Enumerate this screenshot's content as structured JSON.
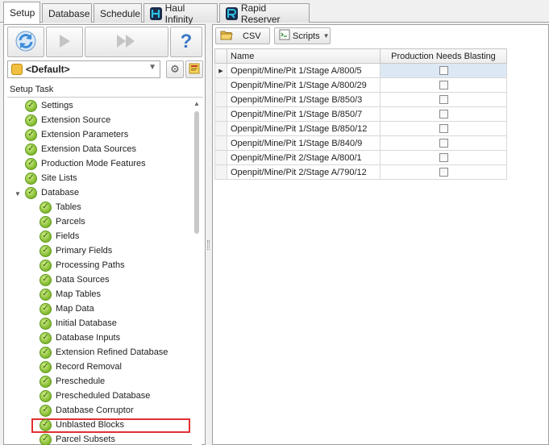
{
  "tabs": [
    {
      "label": "Setup",
      "active": true
    },
    {
      "label": "Database",
      "active": false
    },
    {
      "label": "Schedule",
      "active": false
    },
    {
      "label": "Haul Infinity",
      "active": false,
      "icon": "haul-infinity-logo",
      "color": "#1a2a4a"
    },
    {
      "label": "Rapid Reserver",
      "active": false,
      "icon": "rapid-reserver-logo",
      "color": "#1a2a4a"
    }
  ],
  "toolbar": {
    "refresh_icon": "refresh-icon",
    "run_icon": "play-icon",
    "run_all_icon": "fast-forward-icon",
    "help_label": "?"
  },
  "profile": {
    "selected": "<Default>",
    "settings_icon": "gear-icon",
    "notes_icon": "notes-icon"
  },
  "tree": {
    "header": "Setup Task",
    "items": [
      {
        "label": "Settings",
        "level": 0
      },
      {
        "label": "Extension Source",
        "level": 0
      },
      {
        "label": "Extension Parameters",
        "level": 0
      },
      {
        "label": "Extension Data Sources",
        "level": 0
      },
      {
        "label": "Production Mode Features",
        "level": 0
      },
      {
        "label": "Site Lists",
        "level": 0
      },
      {
        "label": "Database",
        "level": 0,
        "expanded": true
      },
      {
        "label": "Tables",
        "level": 1
      },
      {
        "label": "Parcels",
        "level": 1
      },
      {
        "label": "Fields",
        "level": 1
      },
      {
        "label": "Primary Fields",
        "level": 1
      },
      {
        "label": "Processing Paths",
        "level": 1
      },
      {
        "label": "Data Sources",
        "level": 1
      },
      {
        "label": "Map Tables",
        "level": 1
      },
      {
        "label": "Map Data",
        "level": 1
      },
      {
        "label": "Initial Database",
        "level": 1
      },
      {
        "label": "Database Inputs",
        "level": 1
      },
      {
        "label": "Extension Refined Database",
        "level": 1
      },
      {
        "label": "Record Removal",
        "level": 1
      },
      {
        "label": "Preschedule",
        "level": 1
      },
      {
        "label": "Prescheduled Database",
        "level": 1
      },
      {
        "label": "Database Corruptor",
        "level": 1
      },
      {
        "label": "Unblasted Blocks",
        "level": 1,
        "selected": true
      },
      {
        "label": "Parcel Subsets",
        "level": 1
      }
    ]
  },
  "right_toolbar": {
    "csv_label": "CSV",
    "scripts_label": "Scripts"
  },
  "grid": {
    "columns": [
      "Name",
      "Production Needs Blasting"
    ],
    "rows": [
      {
        "name": "Openpit/Mine/Pit 1/Stage A/800/5",
        "checked": false
      },
      {
        "name": "Openpit/Mine/Pit 1/Stage A/800/29",
        "checked": false
      },
      {
        "name": "Openpit/Mine/Pit 1/Stage B/850/3",
        "checked": false
      },
      {
        "name": "Openpit/Mine/Pit 1/Stage B/850/7",
        "checked": false
      },
      {
        "name": "Openpit/Mine/Pit 1/Stage B/850/12",
        "checked": false
      },
      {
        "name": "Openpit/Mine/Pit 1/Stage B/840/9",
        "checked": false
      },
      {
        "name": "Openpit/Mine/Pit 2/Stage A/800/1",
        "checked": false
      },
      {
        "name": "Openpit/Mine/Pit 2/Stage A/790/12",
        "checked": false
      }
    ]
  },
  "colors": {
    "accent_highlight": "#e03030",
    "check_green": "#7fb72c",
    "refresh_blue": "#3c8dd8",
    "help_blue": "#3a78c8"
  }
}
